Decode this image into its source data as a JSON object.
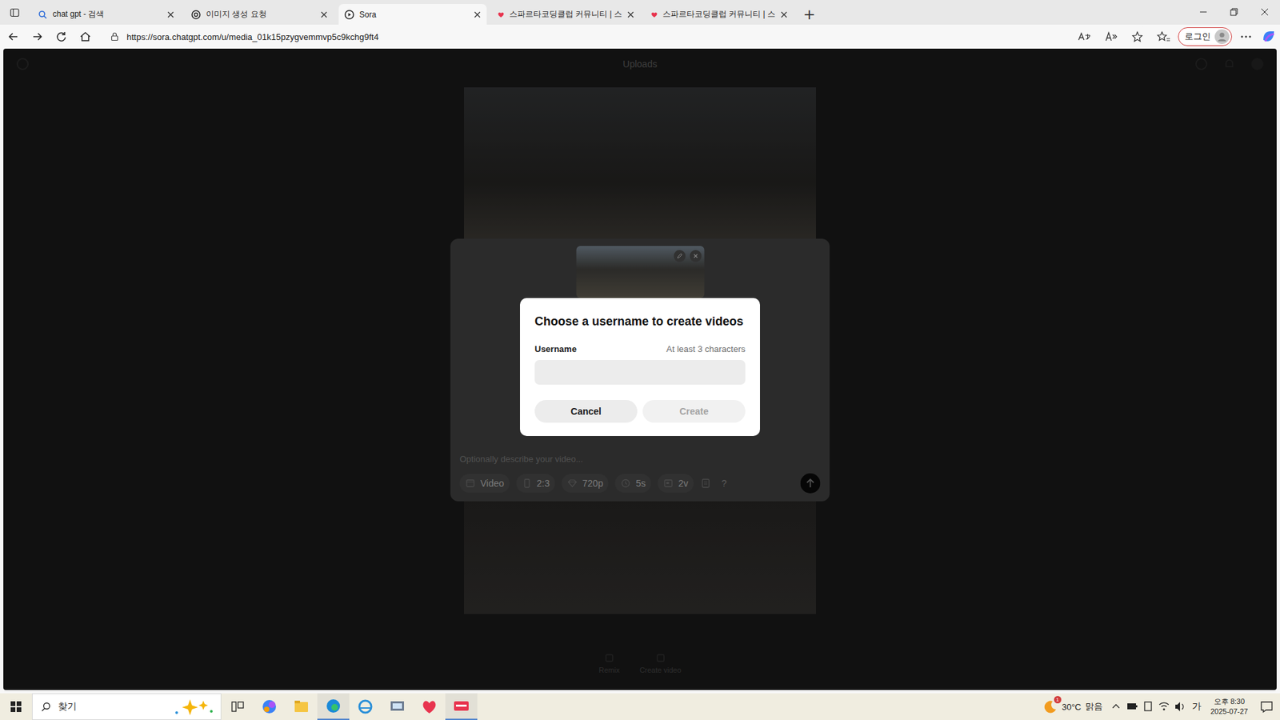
{
  "browser": {
    "tabs": [
      {
        "label": "chat gpt - 검색",
        "selected": false,
        "kind": "search"
      },
      {
        "label": "이미지 생성 요청",
        "selected": false,
        "kind": "openai"
      },
      {
        "label": "Sora",
        "selected": true,
        "kind": "sora"
      },
      {
        "label": "스파르타코딩클럽 커뮤니티 | 스",
        "selected": false,
        "kind": "sparta"
      },
      {
        "label": "스파르타코딩클럽 커뮤니티 | 스",
        "selected": false,
        "kind": "sparta"
      }
    ],
    "new_tab": "+",
    "address": {
      "url": "https://sora.chatgpt.com/u/media_01k15pzygvemmvp5c9kchg9ft4"
    },
    "login": "로그인"
  },
  "page": {
    "header": "Uploads",
    "composer": {
      "placeholder": "Optionally describe your video...",
      "options": [
        {
          "label": "Video"
        },
        {
          "label": "2:3"
        },
        {
          "label": "720p"
        },
        {
          "label": "5s"
        },
        {
          "label": "2v"
        }
      ],
      "help": "?"
    },
    "bottom_actions": [
      "Remix",
      "Create video"
    ]
  },
  "dialog": {
    "title": "Choose a username to create videos",
    "field_label": "Username",
    "hint": "At least 3 characters",
    "value": "",
    "buttons": [
      {
        "label": "Cancel",
        "disabled": false
      },
      {
        "label": "Create",
        "disabled": true
      }
    ]
  },
  "taskbar": {
    "search_placeholder": "찾기",
    "weather": {
      "temp": "30°C",
      "text": "맑음",
      "badge": "1"
    },
    "ime": "가",
    "time": "오후 8:30",
    "date": "2025-07-27"
  }
}
